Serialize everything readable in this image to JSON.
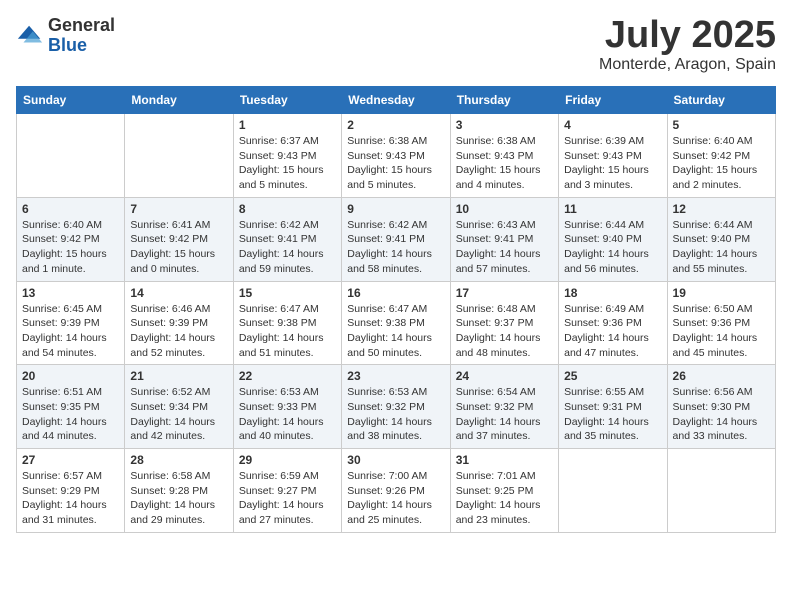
{
  "header": {
    "logo_general": "General",
    "logo_blue": "Blue",
    "month_title": "July 2025",
    "location": "Monterde, Aragon, Spain"
  },
  "weekdays": [
    "Sunday",
    "Monday",
    "Tuesday",
    "Wednesday",
    "Thursday",
    "Friday",
    "Saturday"
  ],
  "weeks": [
    [
      {
        "day": "",
        "sunrise": "",
        "sunset": "",
        "daylight": ""
      },
      {
        "day": "",
        "sunrise": "",
        "sunset": "",
        "daylight": ""
      },
      {
        "day": "1",
        "sunrise": "Sunrise: 6:37 AM",
        "sunset": "Sunset: 9:43 PM",
        "daylight": "Daylight: 15 hours and 5 minutes."
      },
      {
        "day": "2",
        "sunrise": "Sunrise: 6:38 AM",
        "sunset": "Sunset: 9:43 PM",
        "daylight": "Daylight: 15 hours and 5 minutes."
      },
      {
        "day": "3",
        "sunrise": "Sunrise: 6:38 AM",
        "sunset": "Sunset: 9:43 PM",
        "daylight": "Daylight: 15 hours and 4 minutes."
      },
      {
        "day": "4",
        "sunrise": "Sunrise: 6:39 AM",
        "sunset": "Sunset: 9:43 PM",
        "daylight": "Daylight: 15 hours and 3 minutes."
      },
      {
        "day": "5",
        "sunrise": "Sunrise: 6:40 AM",
        "sunset": "Sunset: 9:42 PM",
        "daylight": "Daylight: 15 hours and 2 minutes."
      }
    ],
    [
      {
        "day": "6",
        "sunrise": "Sunrise: 6:40 AM",
        "sunset": "Sunset: 9:42 PM",
        "daylight": "Daylight: 15 hours and 1 minute."
      },
      {
        "day": "7",
        "sunrise": "Sunrise: 6:41 AM",
        "sunset": "Sunset: 9:42 PM",
        "daylight": "Daylight: 15 hours and 0 minutes."
      },
      {
        "day": "8",
        "sunrise": "Sunrise: 6:42 AM",
        "sunset": "Sunset: 9:41 PM",
        "daylight": "Daylight: 14 hours and 59 minutes."
      },
      {
        "day": "9",
        "sunrise": "Sunrise: 6:42 AM",
        "sunset": "Sunset: 9:41 PM",
        "daylight": "Daylight: 14 hours and 58 minutes."
      },
      {
        "day": "10",
        "sunrise": "Sunrise: 6:43 AM",
        "sunset": "Sunset: 9:41 PM",
        "daylight": "Daylight: 14 hours and 57 minutes."
      },
      {
        "day": "11",
        "sunrise": "Sunrise: 6:44 AM",
        "sunset": "Sunset: 9:40 PM",
        "daylight": "Daylight: 14 hours and 56 minutes."
      },
      {
        "day": "12",
        "sunrise": "Sunrise: 6:44 AM",
        "sunset": "Sunset: 9:40 PM",
        "daylight": "Daylight: 14 hours and 55 minutes."
      }
    ],
    [
      {
        "day": "13",
        "sunrise": "Sunrise: 6:45 AM",
        "sunset": "Sunset: 9:39 PM",
        "daylight": "Daylight: 14 hours and 54 minutes."
      },
      {
        "day": "14",
        "sunrise": "Sunrise: 6:46 AM",
        "sunset": "Sunset: 9:39 PM",
        "daylight": "Daylight: 14 hours and 52 minutes."
      },
      {
        "day": "15",
        "sunrise": "Sunrise: 6:47 AM",
        "sunset": "Sunset: 9:38 PM",
        "daylight": "Daylight: 14 hours and 51 minutes."
      },
      {
        "day": "16",
        "sunrise": "Sunrise: 6:47 AM",
        "sunset": "Sunset: 9:38 PM",
        "daylight": "Daylight: 14 hours and 50 minutes."
      },
      {
        "day": "17",
        "sunrise": "Sunrise: 6:48 AM",
        "sunset": "Sunset: 9:37 PM",
        "daylight": "Daylight: 14 hours and 48 minutes."
      },
      {
        "day": "18",
        "sunrise": "Sunrise: 6:49 AM",
        "sunset": "Sunset: 9:36 PM",
        "daylight": "Daylight: 14 hours and 47 minutes."
      },
      {
        "day": "19",
        "sunrise": "Sunrise: 6:50 AM",
        "sunset": "Sunset: 9:36 PM",
        "daylight": "Daylight: 14 hours and 45 minutes."
      }
    ],
    [
      {
        "day": "20",
        "sunrise": "Sunrise: 6:51 AM",
        "sunset": "Sunset: 9:35 PM",
        "daylight": "Daylight: 14 hours and 44 minutes."
      },
      {
        "day": "21",
        "sunrise": "Sunrise: 6:52 AM",
        "sunset": "Sunset: 9:34 PM",
        "daylight": "Daylight: 14 hours and 42 minutes."
      },
      {
        "day": "22",
        "sunrise": "Sunrise: 6:53 AM",
        "sunset": "Sunset: 9:33 PM",
        "daylight": "Daylight: 14 hours and 40 minutes."
      },
      {
        "day": "23",
        "sunrise": "Sunrise: 6:53 AM",
        "sunset": "Sunset: 9:32 PM",
        "daylight": "Daylight: 14 hours and 38 minutes."
      },
      {
        "day": "24",
        "sunrise": "Sunrise: 6:54 AM",
        "sunset": "Sunset: 9:32 PM",
        "daylight": "Daylight: 14 hours and 37 minutes."
      },
      {
        "day": "25",
        "sunrise": "Sunrise: 6:55 AM",
        "sunset": "Sunset: 9:31 PM",
        "daylight": "Daylight: 14 hours and 35 minutes."
      },
      {
        "day": "26",
        "sunrise": "Sunrise: 6:56 AM",
        "sunset": "Sunset: 9:30 PM",
        "daylight": "Daylight: 14 hours and 33 minutes."
      }
    ],
    [
      {
        "day": "27",
        "sunrise": "Sunrise: 6:57 AM",
        "sunset": "Sunset: 9:29 PM",
        "daylight": "Daylight: 14 hours and 31 minutes."
      },
      {
        "day": "28",
        "sunrise": "Sunrise: 6:58 AM",
        "sunset": "Sunset: 9:28 PM",
        "daylight": "Daylight: 14 hours and 29 minutes."
      },
      {
        "day": "29",
        "sunrise": "Sunrise: 6:59 AM",
        "sunset": "Sunset: 9:27 PM",
        "daylight": "Daylight: 14 hours and 27 minutes."
      },
      {
        "day": "30",
        "sunrise": "Sunrise: 7:00 AM",
        "sunset": "Sunset: 9:26 PM",
        "daylight": "Daylight: 14 hours and 25 minutes."
      },
      {
        "day": "31",
        "sunrise": "Sunrise: 7:01 AM",
        "sunset": "Sunset: 9:25 PM",
        "daylight": "Daylight: 14 hours and 23 minutes."
      },
      {
        "day": "",
        "sunrise": "",
        "sunset": "",
        "daylight": ""
      },
      {
        "day": "",
        "sunrise": "",
        "sunset": "",
        "daylight": ""
      }
    ]
  ]
}
